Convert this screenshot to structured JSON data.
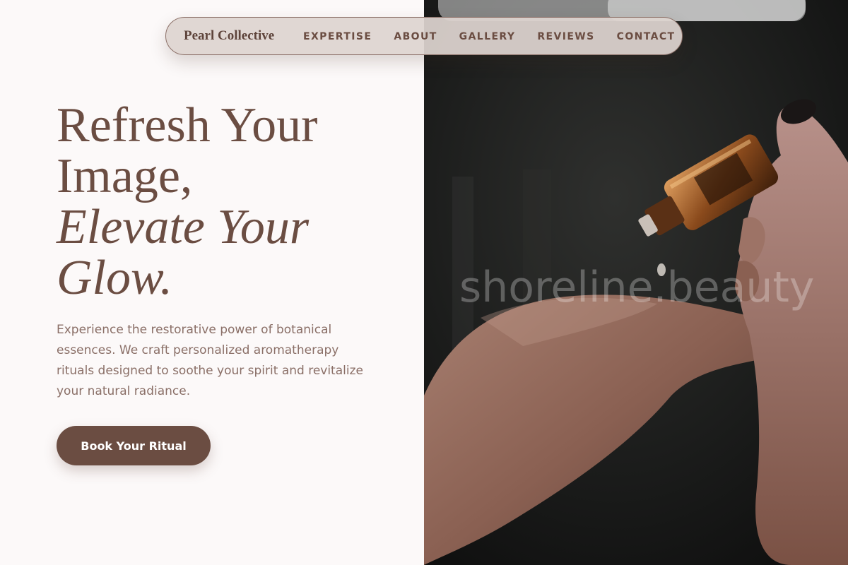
{
  "nav": {
    "brand": "Pearl Collective",
    "links": [
      "EXPERTISE",
      "ABOUT",
      "GALLERY",
      "REVIEWS",
      "CONTACT"
    ]
  },
  "hero": {
    "headline_line1": "Refresh Your",
    "headline_line2": "Image,",
    "headline_line3": "Elevate Your",
    "headline_line4": "Glow.",
    "description": "Experience the restorative power of botanical essences. We craft personalized aromatherapy rituals designed to soothe your spirit and revitalize your natural radiance.",
    "cta_label": "Book Your Ritual"
  },
  "image": {
    "watermark": "shoreline.beauty"
  },
  "colors": {
    "accent": "#6b4d42",
    "background": "#fcf9f9",
    "text_muted": "#8a6f67",
    "nav_bg": "#ded4d0"
  }
}
